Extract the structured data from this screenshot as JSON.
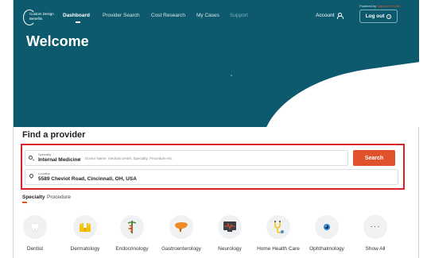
{
  "brand": {
    "logo_text": "Custom Design Benefits",
    "powered_by_prefix": "Powered by",
    "powered_by_name": "Sapphire Health",
    "accent": "#e0522b",
    "primary": "#0d5a6e"
  },
  "nav": {
    "items": [
      {
        "label": "Dashboard",
        "active": true
      },
      {
        "label": "Provider Search"
      },
      {
        "label": "Cost Research"
      },
      {
        "label": "My Cases"
      },
      {
        "label": "Support",
        "disabled": true
      }
    ],
    "account_label": "Account",
    "logout_label": "Log out"
  },
  "hero": {
    "title": "Welcome"
  },
  "find": {
    "title": "Find a provider",
    "specialty_label": "Specialty",
    "specialty_value": "Internal Medicine",
    "specialty_placeholder": "Doctor Name, medical center, Specialty, Procedure etc.",
    "search_label": "Search",
    "location_label": "Location",
    "location_value": "5589 Cheviot Road, Cincinnati, OH, USA"
  },
  "tabs": [
    {
      "label": "Specialty",
      "active": true
    },
    {
      "label": "Procedure"
    }
  ],
  "specialties": [
    {
      "label": "Dentist",
      "icon": "tooth-icon"
    },
    {
      "label": "Dermatology",
      "icon": "hands-icon"
    },
    {
      "label": "Endocrinology",
      "icon": "caduceus-icon"
    },
    {
      "label": "Gastroenterology",
      "icon": "liver-icon"
    },
    {
      "label": "Neurology",
      "icon": "monitor-pulse-icon"
    },
    {
      "label": "Home Health Care",
      "icon": "stethoscope-icon"
    },
    {
      "label": "Ophthalmology",
      "icon": "eye-icon"
    },
    {
      "label": "Show All",
      "icon": "ellipsis-icon"
    }
  ]
}
